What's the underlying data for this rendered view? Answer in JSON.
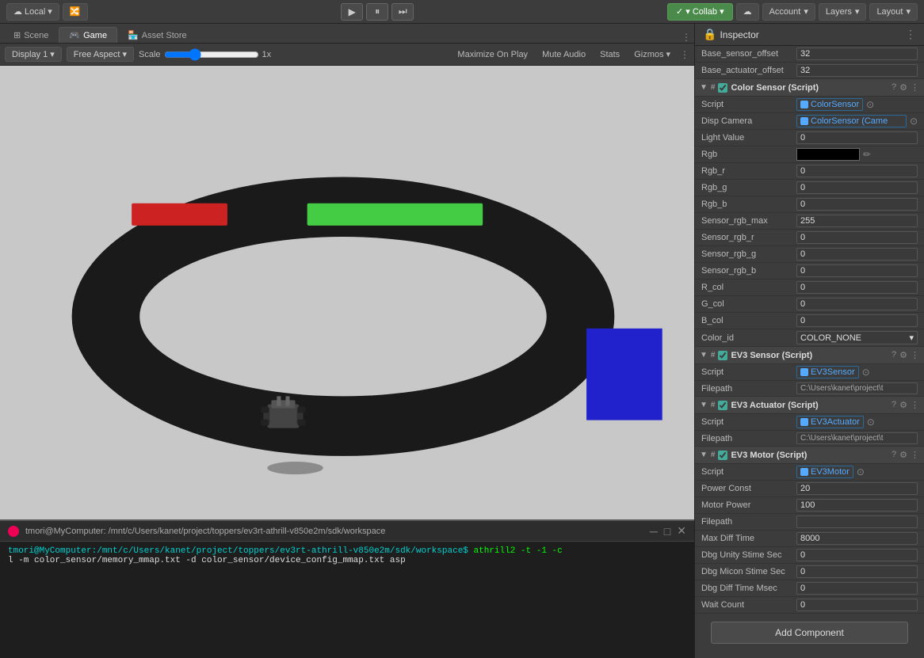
{
  "topbar": {
    "local_label": "Local",
    "collab_label": "▾ Collab ▾",
    "account_label": "Account",
    "layers_label": "Layers",
    "layout_label": "Layout"
  },
  "tabs": {
    "scene_label": "Scene",
    "game_label": "Game",
    "asset_store_label": "Asset Store"
  },
  "game_toolbar": {
    "display_label": "Display 1",
    "aspect_label": "Free Aspect",
    "scale_label": "Scale",
    "scale_value": "1x",
    "maximize_label": "Maximize On Play",
    "mute_label": "Mute Audio",
    "stats_label": "Stats",
    "gizmos_label": "Gizmos"
  },
  "inspector": {
    "title": "Inspector",
    "base_sensor_offset_label": "Base_sensor_offset",
    "base_sensor_offset_value": "32",
    "base_actuator_offset_label": "Base_actuator_offset",
    "base_actuator_offset_value": "32",
    "color_sensor_title": "Color Sensor (Script)",
    "color_sensor_script_label": "Script",
    "color_sensor_script_value": "ColorSensor",
    "disp_camera_label": "Disp Camera",
    "disp_camera_value": "ColorSensor (Came",
    "light_value_label": "Light Value",
    "light_value_value": "0",
    "rgb_label": "Rgb",
    "rgb_r_label": "Rgb_r",
    "rgb_r_value": "0",
    "rgb_g_label": "Rgb_g",
    "rgb_g_value": "0",
    "rgb_b_label": "Rgb_b",
    "rgb_b_value": "0",
    "sensor_rgb_max_label": "Sensor_rgb_max",
    "sensor_rgb_max_value": "255",
    "sensor_rgb_r_label": "Sensor_rgb_r",
    "sensor_rgb_r_value": "0",
    "sensor_rgb_g_label": "Sensor_rgb_g",
    "sensor_rgb_g_value": "0",
    "sensor_rgb_b_label": "Sensor_rgb_b",
    "sensor_rgb_b_value": "0",
    "r_col_label": "R_col",
    "r_col_value": "0",
    "g_col_label": "G_col",
    "g_col_value": "0",
    "b_col_label": "B_col",
    "b_col_value": "0",
    "color_id_label": "Color_id",
    "color_id_value": "COLOR_NONE",
    "ev3_sensor_title": "EV3 Sensor (Script)",
    "ev3_sensor_script_label": "Script",
    "ev3_sensor_script_value": "EV3Sensor",
    "ev3_sensor_filepath_label": "Filepath",
    "ev3_sensor_filepath_value": "C:\\Users\\kanet\\project\\t",
    "ev3_actuator_title": "EV3 Actuator (Script)",
    "ev3_actuator_script_label": "Script",
    "ev3_actuator_script_value": "EV3Actuator",
    "ev3_actuator_filepath_label": "Filepath",
    "ev3_actuator_filepath_value": "C:\\Users\\kanet\\project\\t",
    "ev3_motor_title": "EV3 Motor (Script)",
    "ev3_motor_script_label": "Script",
    "ev3_motor_script_value": "EV3Motor",
    "power_const_label": "Power Const",
    "power_const_value": "20",
    "motor_power_label": "Motor Power",
    "motor_power_value": "100",
    "filepath_label": "Filepath",
    "filepath_value": "",
    "max_diff_time_label": "Max Diff Time",
    "max_diff_time_value": "8000",
    "dbg_unity_stime_label": "Dbg Unity Stime Sec",
    "dbg_unity_stime_value": "0",
    "dbg_micon_stime_label": "Dbg Micon Stime Sec",
    "dbg_micon_stime_value": "0",
    "dbg_diff_time_label": "Dbg Diff Time Msec",
    "dbg_diff_time_value": "0",
    "wait_count_label": "Wait Count",
    "wait_count_value": "0",
    "add_component_label": "Add Component"
  },
  "terminal": {
    "title": "tmori@MyComputer: /mnt/c/Users/kanet/project/toppers/ev3rt-athrill-v850e2m/sdk/workspace",
    "prompt": "tmori@MyComputer:/mnt/c/Users/kanet/project/toppers/ev3rt-athrill-v850e2m/sdk/workspace$",
    "cmd": " athrill2 -t -1 -c",
    "line2": "l -m color_sensor/memory_mmap.txt -d color_sensor/device_config_mmap.txt asp"
  }
}
